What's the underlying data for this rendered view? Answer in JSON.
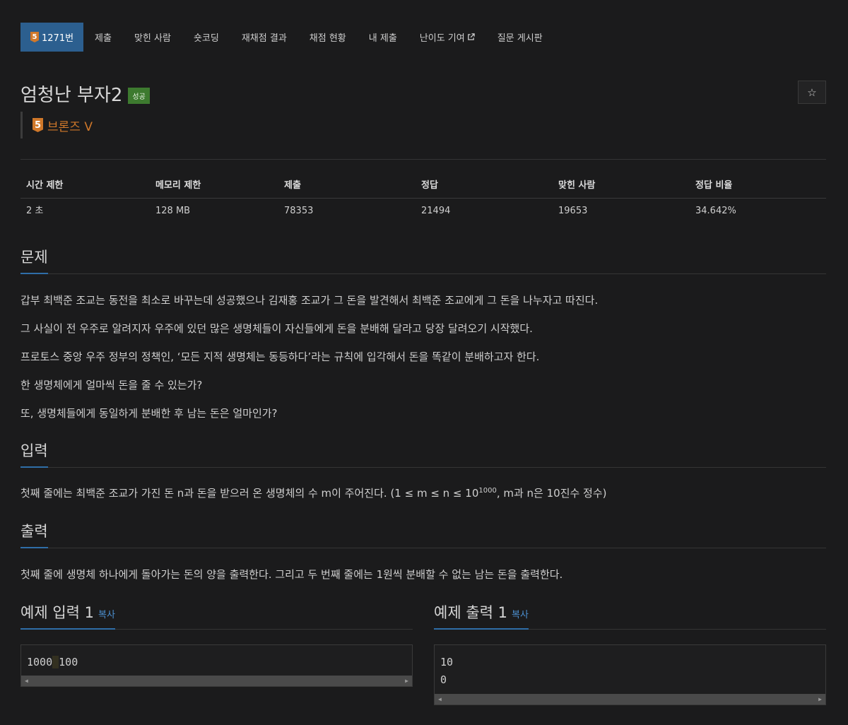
{
  "nav": {
    "active_tier": "5",
    "items": [
      "1271번",
      "제출",
      "맞힌 사람",
      "숏코딩",
      "재채점 결과",
      "채점 현황",
      "내 제출",
      "난이도 기여",
      "질문 게시판"
    ]
  },
  "problem": {
    "title": "엄청난 부자2",
    "status": "성공",
    "tier_number": "5",
    "tier_name": "브론즈 V"
  },
  "stats": {
    "headers": [
      "시간 제한",
      "메모리 제한",
      "제출",
      "정답",
      "맞힌 사람",
      "정답 비율"
    ],
    "values": [
      "2 초",
      "128 MB",
      "78353",
      "21494",
      "19653",
      "34.642%"
    ]
  },
  "sections": {
    "problem_title": "문제",
    "problem_lines": [
      "갑부 최백준 조교는 동전을 최소로 바꾸는데 성공했으나 김재홍 조교가 그 돈을 발견해서 최백준 조교에게 그 돈을 나누자고 따진다.",
      "그 사실이 전 우주로 알려지자 우주에 있던 많은 생명체들이 자신들에게 돈을 분배해 달라고 당장 달려오기 시작했다.",
      "프로토스 중앙 우주 정부의 정책인, ‘모든 지적 생명체는 동등하다’라는 규칙에 입각해서 돈을 똑같이 분배하고자 한다.",
      "한 생명체에게 얼마씩 돈을 줄 수 있는가?",
      "또, 생명체들에게 동일하게 분배한 후 남는 돈은 얼마인가?"
    ],
    "input_title": "입력",
    "input_pre": "첫째 줄에는 최백준 조교가 가진 돈 n과 돈을 받으러 온 생명체의 수 m이 주어진다. (1 ≤ m ≤ n ≤ 10",
    "input_sup": "1000",
    "input_post": ", m과 n은 10진수 정수)",
    "output_title": "출력",
    "output_text": "첫째 줄에 생명체 하나에게 돌아가는 돈의 양을 출력한다. 그리고 두 번째 줄에는 1원씩 분배할 수 없는 남는 돈을 출력한다."
  },
  "examples": {
    "input_title": "예제 입력 1",
    "output_title": "예제 출력 1",
    "copy_label": "복사",
    "input_a": "1000",
    "input_b": "100",
    "output_lines": [
      "10",
      "0"
    ]
  }
}
